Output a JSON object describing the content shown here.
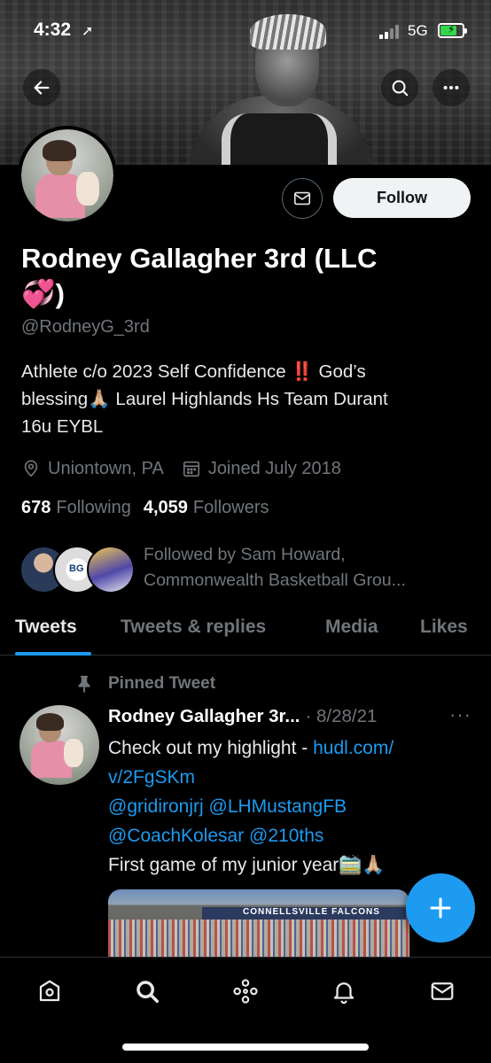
{
  "status_bar": {
    "time": "4:32",
    "location_glyph": "➚",
    "network": "5G",
    "battery_fill": 0.75,
    "battery_color": "#32d74b"
  },
  "profile": {
    "name_line1": "Rodney Gallagher 3rd (LLC",
    "name_line2": "💞)",
    "handle": "@RodneyG_3rd",
    "bio_line1": "Athlete c/o 2023 Self Confidence ‼️ God’s",
    "bio_line2": "blessing🙏🏼 Laurel Highlands Hs Team Durant",
    "bio_line3": "16u EYBL",
    "location": "Uniontown, PA",
    "joined": "Joined July 2018",
    "following_count": "678",
    "following_label": "Following",
    "followers_count": "4,059",
    "followers_label": "Followers",
    "followed_by_line1": "Followed by Sam Howard,",
    "followed_by_line2": "Commonwealth Basketball Grou...",
    "mutual_avatar_text": "BG",
    "follow_label": "Follow"
  },
  "tabs": [
    {
      "label": "Tweets",
      "active": true
    },
    {
      "label": "Tweets & replies",
      "active": false
    },
    {
      "label": "Media",
      "active": false
    },
    {
      "label": "Likes",
      "active": false
    }
  ],
  "tweet": {
    "pinned_label": "Pinned Tweet",
    "author": "Rodney Gallagher 3r...",
    "date": "· 8/28/21",
    "more": "···",
    "line1_text": "Check out my highlight - ",
    "line1_link": "hudl.com/",
    "line2_link": "v/2FgSKm",
    "line3": "@gridironjrj @LHMustangFB",
    "line4": "@CoachKolesar @210ths",
    "line5": "First game of my junior year🚞🙏🏼",
    "media_wall_text": "CONNELLSVILLE  FALCONS"
  },
  "icons": {
    "back": "arrow-left-icon",
    "search": "search-icon",
    "more": "more-icon",
    "mail": "mail-icon",
    "location": "location-pin-icon",
    "calendar": "calendar-icon",
    "pin": "pin-icon",
    "compose": "plus-icon",
    "nav": [
      "home-icon",
      "search-icon",
      "spaces-icon",
      "bell-icon",
      "mail-icon"
    ]
  },
  "colors": {
    "accent": "#1d9bf0",
    "background": "#000000",
    "muted_text": "#71767b",
    "primary_text": "#e7e9ea"
  }
}
